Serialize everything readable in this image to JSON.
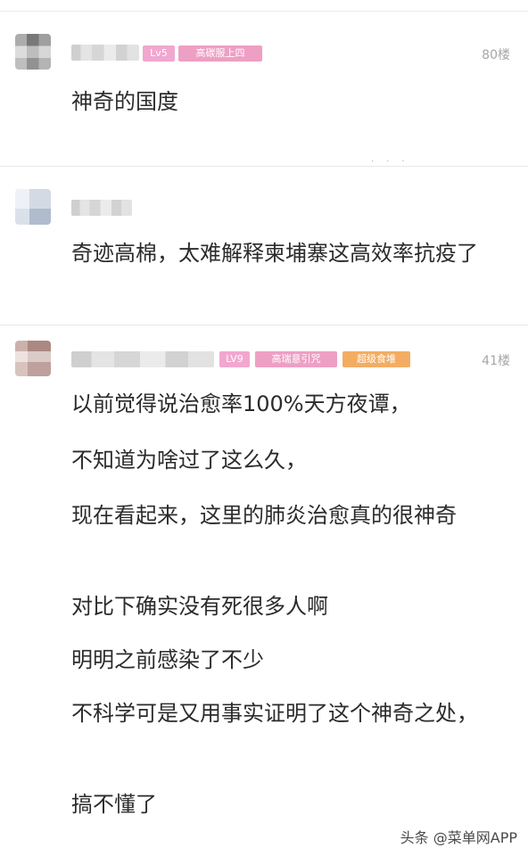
{
  "comments": [
    {
      "floor": "80楼",
      "badges": [
        "Lv5",
        "高碳服上四"
      ],
      "text_lines": [
        "神奇的国度"
      ]
    },
    {
      "floor": "",
      "badges": [],
      "text_lines": [
        "奇迹高棉，太难解释柬埔寨这高效率抗疫了"
      ]
    },
    {
      "floor": "41楼",
      "badges": [
        "LV9",
        "高瑞意引咒",
        "超级食堆"
      ],
      "text_lines": [
        "以前觉得说治愈率100%天方夜谭，",
        "不知道为啥过了这么久，",
        "现在看起来，这里的肺炎治愈真的很神奇",
        "对比下确实没有死很多人啊",
        "明明之前感染了不少",
        "不科学可是又用事实证明了这个神奇之处，",
        "搞不懂了"
      ]
    }
  ],
  "watermark": "头条 @菜单网APP",
  "colors": {
    "badge_pink": "#f1a7cf",
    "badge_orange": "#f3ad63",
    "floor_gray": "#a6a6a6",
    "text": "#2b2b2b"
  }
}
